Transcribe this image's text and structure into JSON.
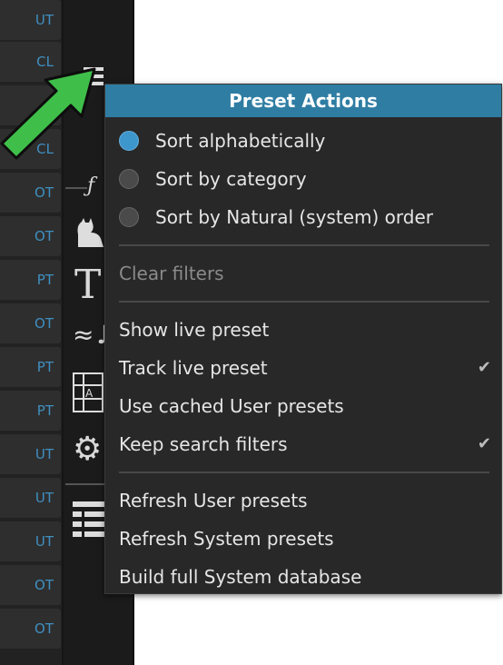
{
  "left_list": [
    "UT",
    "CL",
    "",
    "CL",
    "OT",
    "OT",
    "PT",
    "OT",
    "PT",
    "PT",
    "UT",
    "UT",
    "UT",
    "OT",
    "OT"
  ],
  "toolbar_icons": [
    "menu-icon",
    "function-icon",
    "cat-icon",
    "text-icon",
    "music-icon",
    "grid-letter-icon",
    "gear-icon",
    "table-icon"
  ],
  "menu": {
    "title": "Preset Actions",
    "sort_options": [
      {
        "label": "Sort alphabetically",
        "selected": true
      },
      {
        "label": "Sort by category",
        "selected": false
      },
      {
        "label": "Sort by Natural (system) order",
        "selected": false
      }
    ],
    "clear_filters": "Clear filters",
    "toggles": [
      {
        "label": "Show live preset",
        "checked": false
      },
      {
        "label": "Track live preset",
        "checked": true
      },
      {
        "label": "Use cached User presets",
        "checked": false
      },
      {
        "label": "Keep search filters",
        "checked": true
      }
    ],
    "refresh_user": "Refresh User presets",
    "refresh_system": "Refresh System presets",
    "build_db": "Build full System database",
    "check_glyph": "✔"
  },
  "colors": {
    "accent": "#2f7da3",
    "tag_text": "#3f8fc0",
    "arrow": "#3fbf4a"
  }
}
